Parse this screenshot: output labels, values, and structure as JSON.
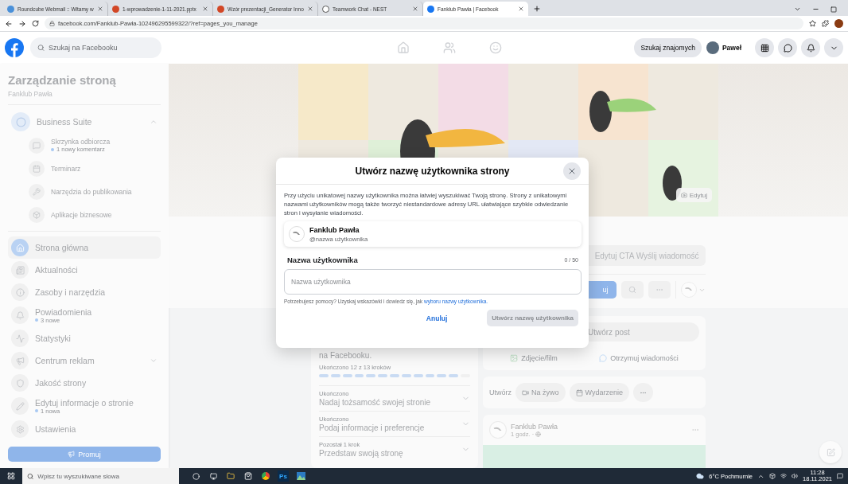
{
  "browser": {
    "tabs": [
      {
        "title": "Roundcube Webmail :: Witamy w",
        "selected": false
      },
      {
        "title": "1-wprowadzenie-1-11-2021.pptx",
        "selected": false
      },
      {
        "title": "Wzór prezentacji_Generator Inno",
        "selected": false
      },
      {
        "title": "Teamwork Chat - NEST",
        "selected": false
      },
      {
        "title": "Fanklub Pawła | Facebook",
        "selected": true
      }
    ],
    "url": "facebook.com/Fanklub-Pawła-102496295599322/?ref=pages_you_manage"
  },
  "header": {
    "search_placeholder": "Szukaj na Facebooku",
    "find_friends": "Szukaj znajomych",
    "user": "Paweł"
  },
  "sidebar": {
    "title": "Zarządzanie stroną",
    "subtitle": "Fanklub Pawła",
    "suite": {
      "label": "Business Suite",
      "expanded": true,
      "children": [
        {
          "label": "Skrzynka odbiorcza",
          "note": "1 nowy komentarz"
        },
        {
          "label": "Terminarz"
        },
        {
          "label": "Narzędzia do publikowania"
        },
        {
          "label": "Aplikacje biznesowe"
        }
      ]
    },
    "items": [
      {
        "label": "Strona główna",
        "selected": true
      },
      {
        "label": "Aktualności",
        "selected": false
      },
      {
        "label": "Zasoby i narzędzia",
        "selected": false
      },
      {
        "label": "Powiadomienia",
        "note": "3 nowe",
        "selected": false
      },
      {
        "label": "Statystyki",
        "selected": false
      },
      {
        "label": "Centrum reklam",
        "selected": false,
        "expandable": true
      },
      {
        "label": "Jakość strony",
        "selected": false
      },
      {
        "label": "Edytuj informacje o stronie",
        "note": "1 nowa",
        "selected": false
      },
      {
        "label": "Ustawienia",
        "selected": false
      }
    ],
    "promote": "Promuj"
  },
  "cover": {
    "kind": "picture",
    "edit": "Edytuj"
  },
  "page_actions": {
    "cta": "Edytuj CTA Wyślij wiadomość",
    "promote": "uj"
  },
  "setup": {
    "intro": "na Facebooku.",
    "progress": "Ukończono 12 z 13 kroków",
    "level": 0.923,
    "steps": [
      {
        "status": "Ukończono",
        "title": "Nadaj tożsamość swojej stronie"
      },
      {
        "status": "Ukończono",
        "title": "Podaj informacje i preferencje"
      },
      {
        "status": "Pozostał 1 krok",
        "title": "Przedstaw swoją stronę"
      }
    ]
  },
  "composer": {
    "placeholder": "Utwórz post",
    "actions": [
      "Zdjęcie/film",
      "Otrzymuj wiadomości"
    ]
  },
  "create": {
    "label": "Utwórz",
    "actions": [
      "Na żywo",
      "Wydarzenie"
    ]
  },
  "post": {
    "author": "Fanklub Pawła",
    "time": "1 godz. ·"
  },
  "modal": {
    "title": "Utwórz nazwę użytkownika strony",
    "description": "Przy użyciu unikatowej nazwy użytkownika można łatwiej wyszukiwać Twoją stronę. Strony z unikatowymi nazwami użytkowników mogą także tworzyć niestandardowe adresy URL ułatwiające szybkie odwiedzanie stron i wysyłanie wiadomości.",
    "preview": {
      "name": "Fanklub Pawła",
      "handle": "@nazwa użytkownika"
    },
    "field_label": "Nazwa użytkownika",
    "counter": "0 / 50",
    "placeholder": "Nazwa użytkownika",
    "help": "Potrzebujesz pomocy? Uzyskaj wskazówki i dowiedz się, jak ",
    "help_link": "wyboru nazwy użytkownika.",
    "cancel": "Anuluj",
    "submit": {
      "label": "Utwórz nazwę użytkownika",
      "disabled": true
    }
  },
  "taskbar": {
    "search_placeholder": "Wpisz tu wyszukiwane słowa",
    "app_label": "Ps",
    "weather": "6°C Pochmurnie",
    "time": "11:28",
    "date": "18.11.2021"
  }
}
